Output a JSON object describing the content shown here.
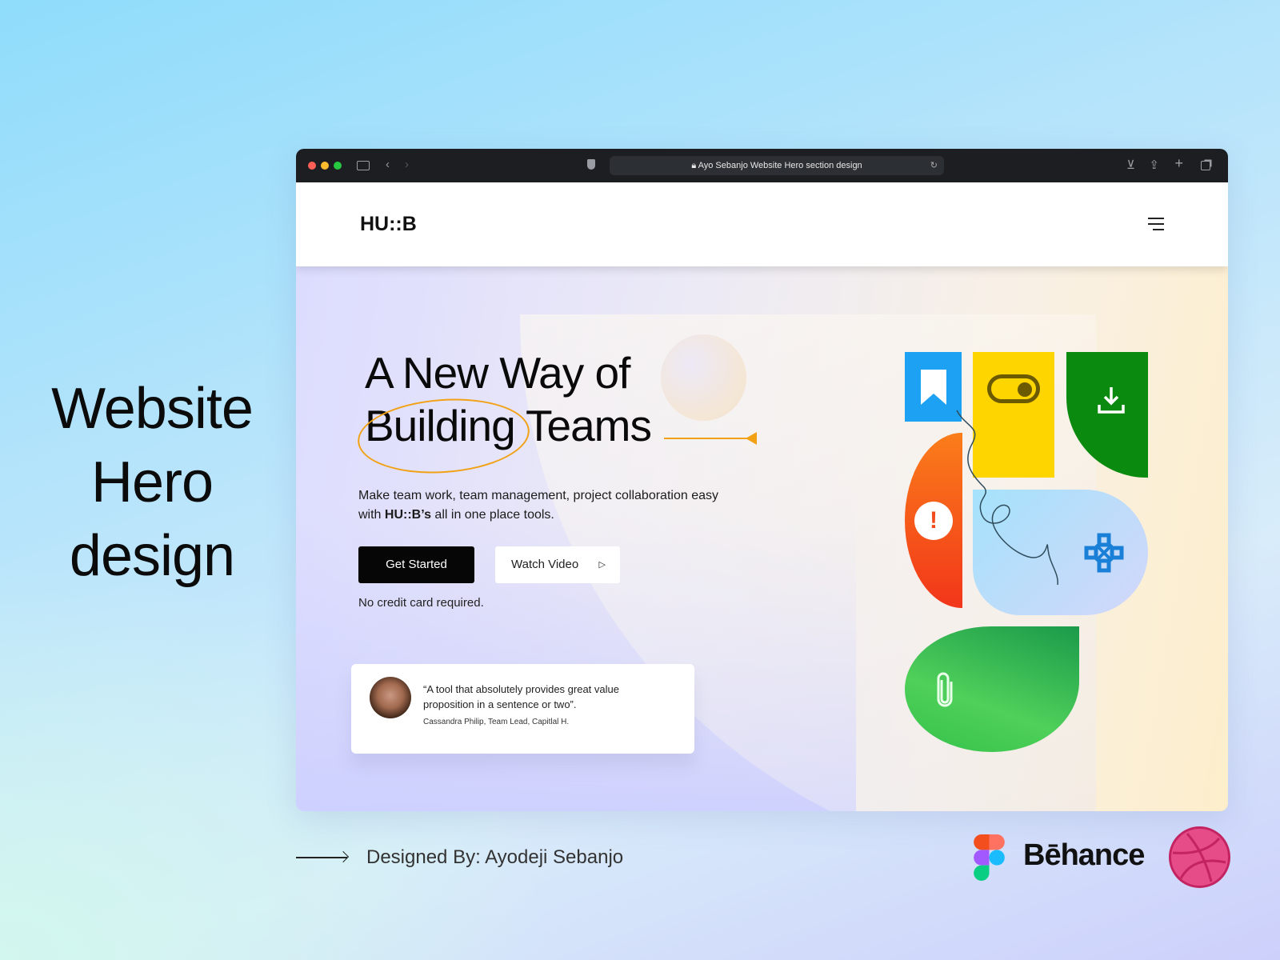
{
  "side_title": [
    "Website",
    "Hero",
    "design"
  ],
  "browser": {
    "url": "Ayo Sebanjo Website Hero section design"
  },
  "site": {
    "logo": "HU::B",
    "hero": {
      "title_line1": "A New Way of",
      "title_word_circled": "Building",
      "title_word2": "Teams",
      "subtitle_line1": "Make team work, team management, project collaboration easy",
      "subtitle_with": "with ",
      "subtitle_brand": "HU::B’s",
      "subtitle_rest": " all in one place tools.",
      "primary_button": "Get Started",
      "secondary_button": "Watch Video",
      "note": "No credit card required."
    },
    "testimonial": {
      "quote_line1": "“A tool that absolutely provides great value",
      "quote_line2": "proposition in a sentence or two”.",
      "author": "Cassandra Philip, Team Lead, Capitlal H."
    }
  },
  "footer": {
    "designed_by": "Designed By:  Ayodeji Sebanjo",
    "behance": "Bēhance"
  },
  "colors": {
    "accent": "#f2a114",
    "blue": "#1da1f2",
    "yellow": "#ffd500",
    "green": "#0a8a0f",
    "orange": "#fa6a1a"
  }
}
